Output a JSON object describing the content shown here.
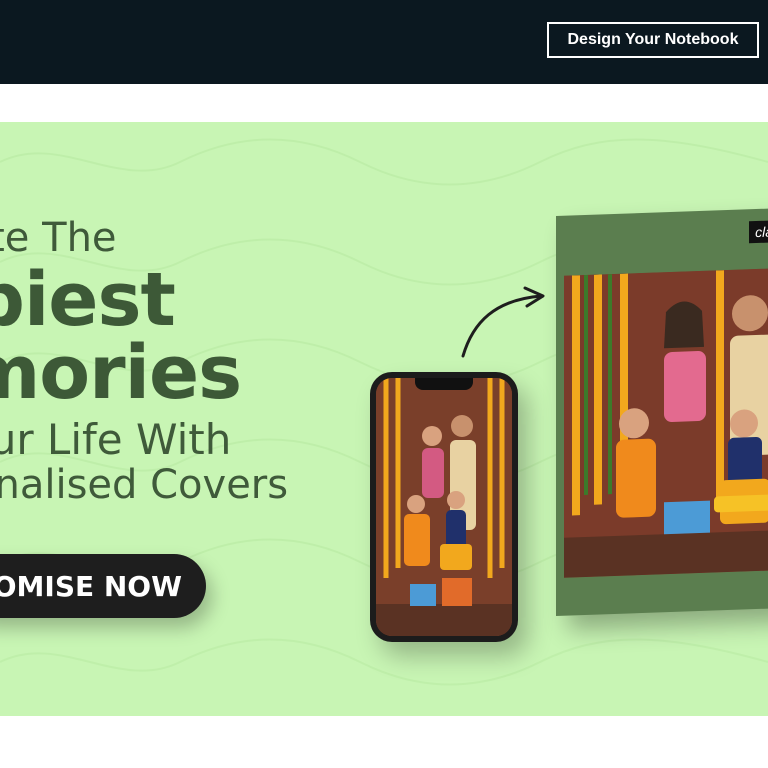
{
  "header": {
    "design_button_label": "Design Your Notebook"
  },
  "banner": {
    "headline": {
      "line1": "eate The",
      "line2": "ppiest",
      "line3": "emories",
      "line4": "our Life With",
      "line5": "onalised Covers"
    },
    "cta_label": "OMISE NOW",
    "notebook_tag": "clas"
  },
  "colors": {
    "header_bg": "#0b1820",
    "banner_bg": "#c8f5b4",
    "headline": "#3d5937",
    "cta_bg": "#1e1e1e",
    "notebook_cover": "#5b7e4f"
  }
}
